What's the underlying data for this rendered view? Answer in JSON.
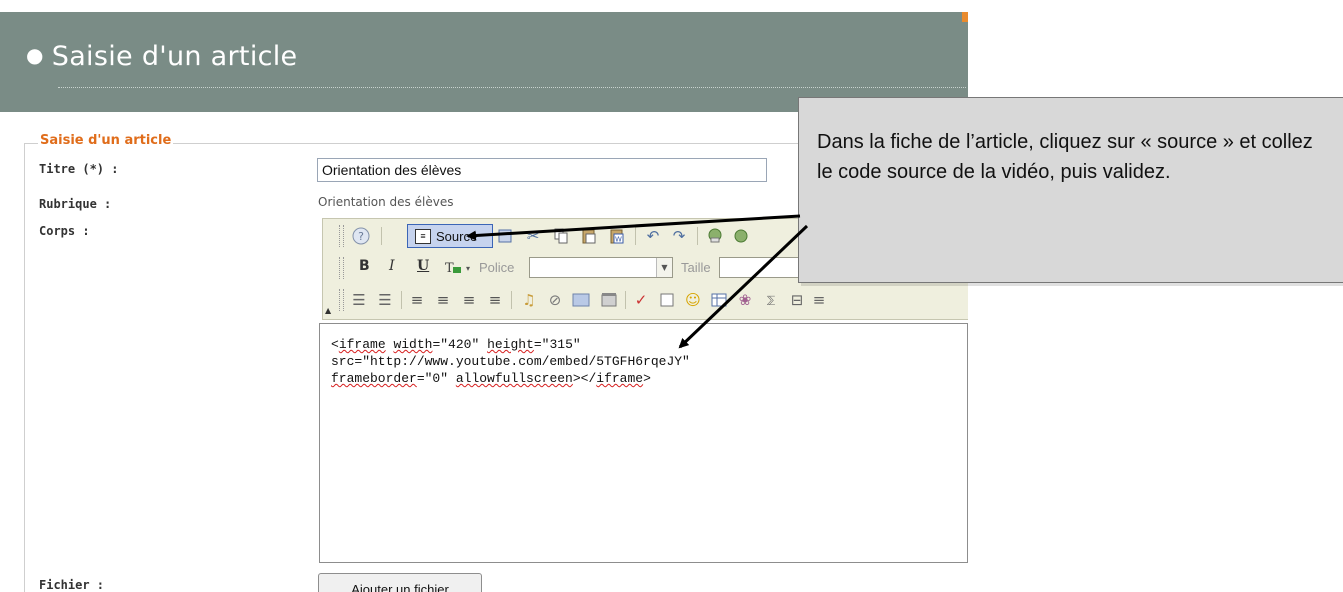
{
  "page": {
    "header_title": "Saisie d'un article",
    "bullet": "●"
  },
  "form": {
    "legend": "Saisie d'un article",
    "titre_label": "Titre (*) :",
    "titre_value": "Orientation des élèves",
    "rubrique_label": "Rubrique :",
    "rubrique_value": "Orientation des élèves",
    "corps_label": "Corps :",
    "fichier_label": "Fichier :",
    "add_file_button": "Ajouter un fichier"
  },
  "editor": {
    "source_button": "Source",
    "font_label": "Police",
    "size_label": "Taille",
    "bold": "B",
    "italic": "I",
    "underline": "U",
    "code_line1_a": "<",
    "code_line1_b": "iframe",
    "code_line1_c": " ",
    "code_line1_d": "width",
    "code_line1_e": "=\"420\" ",
    "code_line1_f": "height",
    "code_line1_g": "=\"315\"",
    "code_line2": "src=\"http://www.youtube.com/embed/5TGFH6rqeJY\"",
    "code_line3_a": "frameborder",
    "code_line3_b": "=\"0\" ",
    "code_line3_c": "allowfullscreen",
    "code_line3_d": "></",
    "code_line3_e": "iframe",
    "code_line3_f": ">"
  },
  "callout": {
    "text": "Dans la fiche de l’article, cliquez sur « source » et collez le code source de la vidéo, puis validez."
  },
  "icons": {
    "help": "help-icon",
    "source": "source-icon",
    "cut": "cut-icon",
    "copy": "copy-icon",
    "paste": "paste-icon",
    "paste_word": "paste-word-icon",
    "undo": "undo-icon",
    "redo": "redo-icon"
  },
  "colors": {
    "header_bg": "#7a8c86",
    "legend": "#e06d1b",
    "source_button_bg": "#c6d3ee",
    "callout_bg": "#d8d8d8"
  }
}
